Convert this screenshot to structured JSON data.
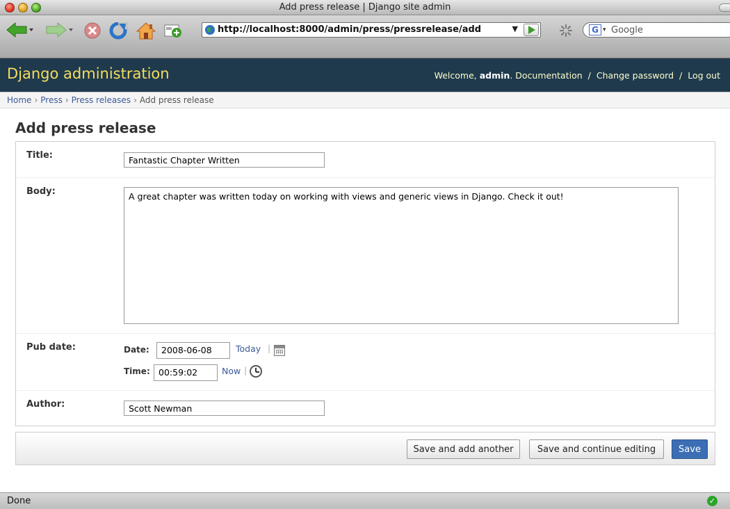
{
  "window": {
    "title": "Add press release | Django site admin"
  },
  "browser": {
    "url": "http://localhost:8000/admin/press/pressrelease/add",
    "url_dropdown": "▼",
    "search_placeholder": "Google",
    "search_engine_letter": "G",
    "status": "Done"
  },
  "header": {
    "brand": "Django administration",
    "welcome_prefix": "Welcome,",
    "username": "admin",
    "username_suffix": ".",
    "links": [
      "Documentation",
      "Change password",
      "Log out"
    ],
    "separator": "/"
  },
  "breadcrumbs": {
    "items": [
      "Home",
      "Press",
      "Press releases"
    ],
    "current": "Add press release",
    "separator": "›"
  },
  "page": {
    "title": "Add press release"
  },
  "form": {
    "title_label": "Title:",
    "title_value": "Fantastic Chapter Written",
    "body_label": "Body:",
    "body_value": "A great chapter was written today on working with views and generic views in Django. Check it out!",
    "pub_date_label": "Pub date:",
    "date_label": "Date:",
    "date_value": "2008-06-08",
    "today_link": "Today",
    "time_label": "Time:",
    "time_value": "00:59:02",
    "now_link": "Now",
    "pipe": "|",
    "author_label": "Author:",
    "author_value": "Scott Newman"
  },
  "actions": {
    "save_add_another": "Save and add another",
    "save_continue": "Save and continue editing",
    "save": "Save"
  },
  "colors": {
    "header_bg": "#1f3a4d",
    "brand": "#f5dd5d",
    "link": "#3b5998",
    "save_button": "#3c6eb4"
  }
}
